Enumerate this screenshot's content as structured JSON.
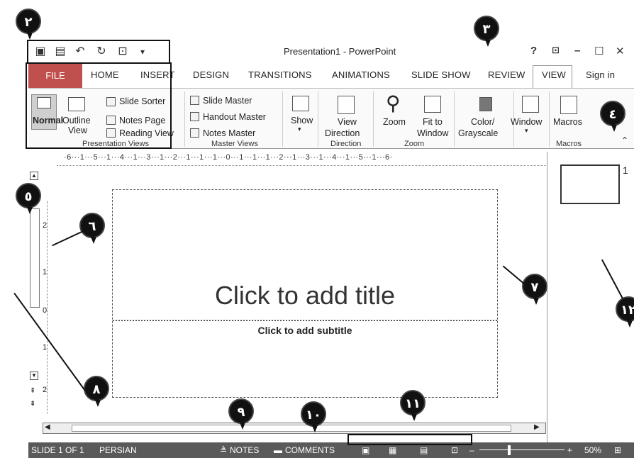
{
  "window": {
    "title": "Presentation1 - PowerPoint",
    "controls": {
      "help": "?",
      "restore": "⊡",
      "minimize": "–",
      "maximize": "☐",
      "close": "✕"
    }
  },
  "qat": [
    {
      "name": "powerpoint-logo-icon",
      "glyph": "▣"
    },
    {
      "name": "save-icon",
      "glyph": "🖫"
    },
    {
      "name": "undo-icon",
      "glyph": "↶"
    },
    {
      "name": "redo-icon",
      "glyph": "↻"
    },
    {
      "name": "start-slideshow-icon",
      "glyph": "⊡"
    },
    {
      "name": "customize-qat-icon",
      "glyph": "▾"
    }
  ],
  "tabs": {
    "file": "FILE",
    "home": "HOME",
    "insert": "INSERT",
    "design": "DESIGN",
    "transitions": "TRANSITIONS",
    "animations": "ANIMATIONS",
    "slideshow": "SLIDE SHOW",
    "review": "REVIEW",
    "view": "VIEW",
    "signin": "Sign in"
  },
  "ribbon": {
    "presentation_views": {
      "label": "Presentation Views",
      "normal": "Normal",
      "outline_view": "Outline View",
      "outline_1": "Outline",
      "outline_2": "View",
      "slide_sorter": "Slide Sorter",
      "notes_page": "Notes Page",
      "reading_view": "Reading View"
    },
    "master_views": {
      "label": "Master Views",
      "slide_master": "Slide Master",
      "handout_master": "Handout Master",
      "notes_master": "Notes Master"
    },
    "show": {
      "label": "Show"
    },
    "direction": {
      "label": "Direction",
      "view_1": "View",
      "view_2": "Direction"
    },
    "zoom": {
      "label": "Zoom",
      "zoom": "Zoom",
      "fit_1": "Fit to",
      "fit_2": "Window"
    },
    "color": {
      "line1": "Color/",
      "line2": "Grayscale"
    },
    "window": {
      "label": "Window"
    },
    "macros": {
      "label": "Macros",
      "button": "Macros"
    }
  },
  "ruler": {
    "horizontal": "·6···1···5···1···4···1···3···1···2···1···1···1···0···1···1···1···2···1···3···1···4···1···5···1···6·",
    "vertical_ticks": [
      "2",
      "1",
      "0",
      "1",
      "2"
    ]
  },
  "slide": {
    "title_placeholder": "Click to add title",
    "subtitle_placeholder": "Click to add subtitle"
  },
  "thumbnails": {
    "first_number": "1"
  },
  "statusbar": {
    "slide_info": "SLIDE 1 OF 1",
    "language": "PERSIAN",
    "notes": "NOTES",
    "comments": "COMMENTS",
    "zoom_level": "50%"
  },
  "callouts": [
    "٢",
    "٣",
    "٤",
    "٥",
    "٦",
    "٧",
    "٨",
    "٩",
    "١٠",
    "١١",
    "١٢"
  ]
}
